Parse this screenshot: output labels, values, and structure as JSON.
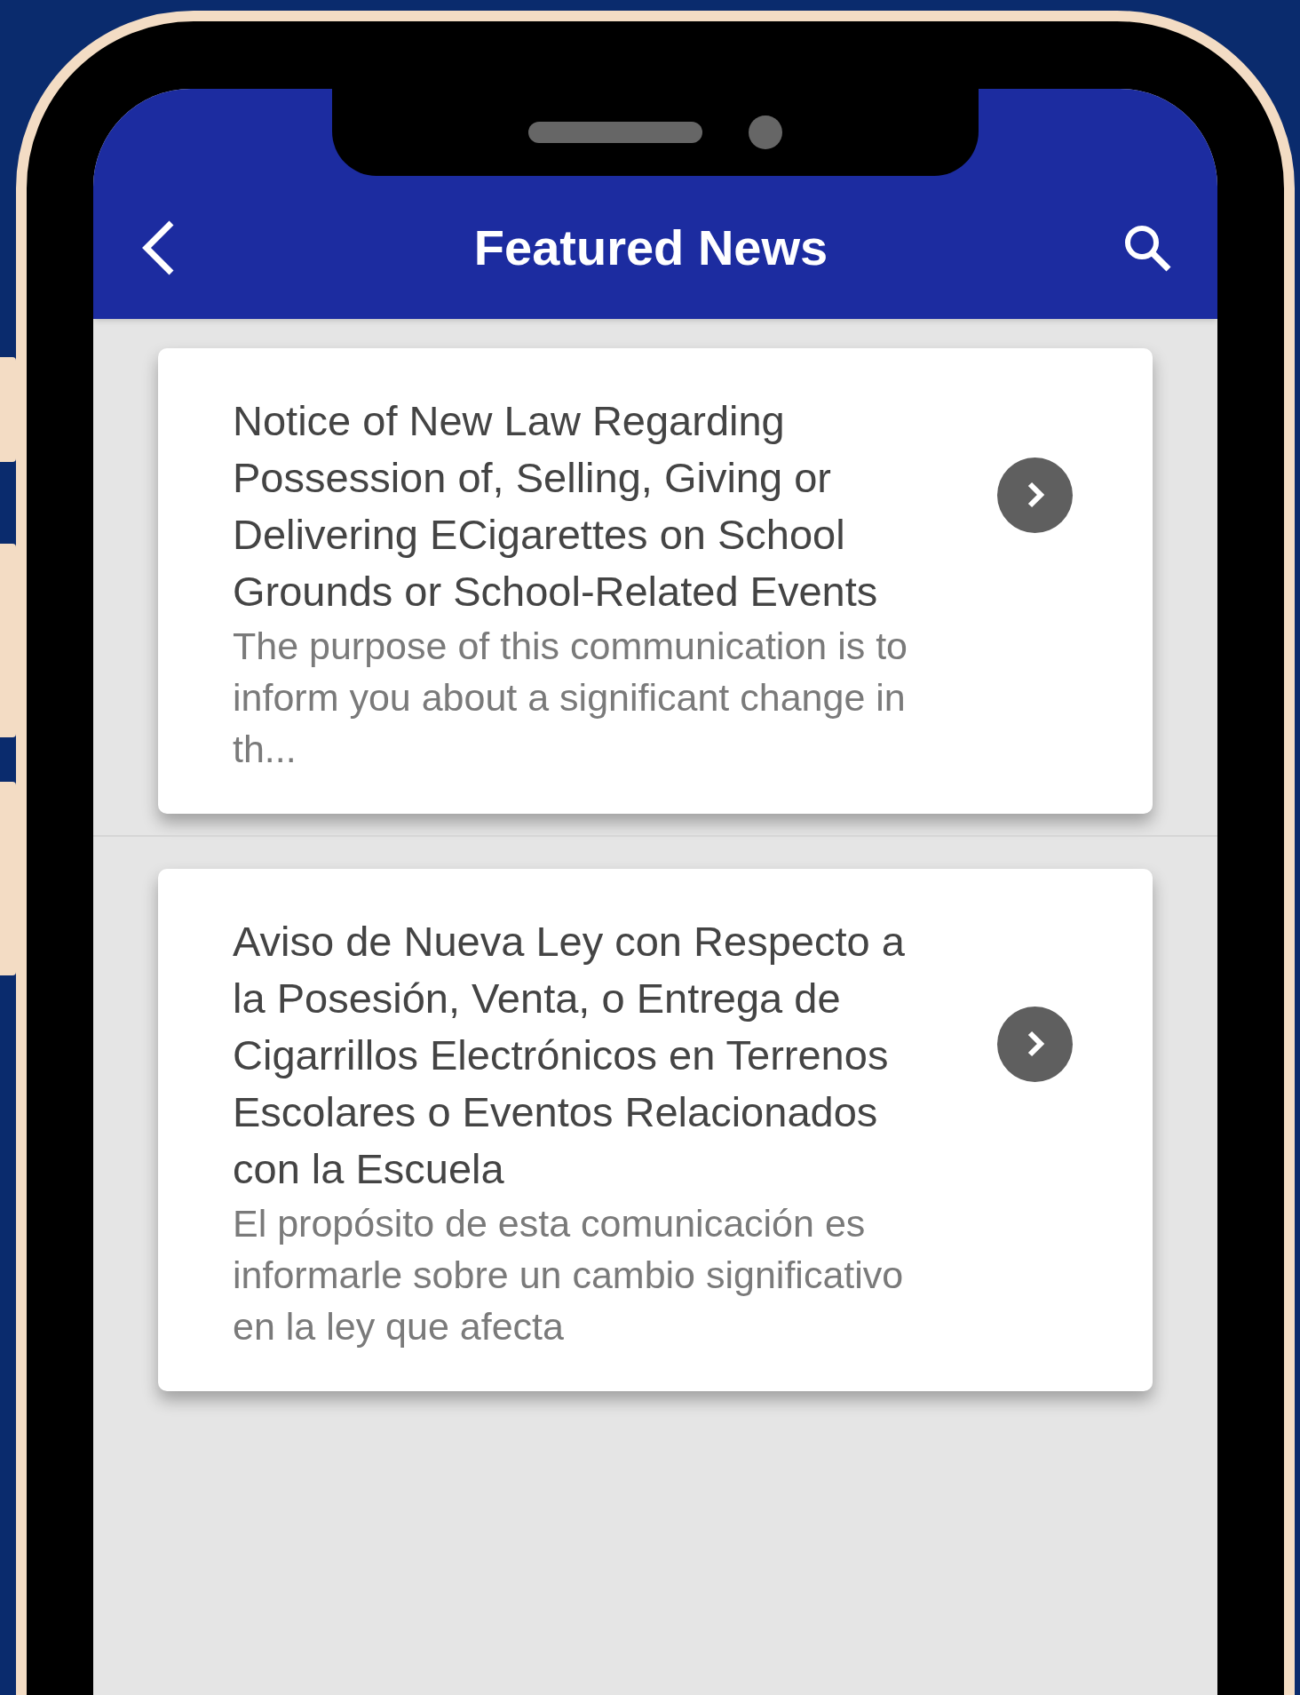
{
  "app_bar": {
    "title": "Featured News"
  },
  "news_items": [
    {
      "title": "Notice of New Law Regarding Possession of, Selling, Giving or Delivering ECigarettes on School Grounds or School-Related Events",
      "summary": "The purpose of this communication is to inform you about a significant change in th..."
    },
    {
      "title": "Aviso de Nueva Ley con Respecto a la Posesión, Venta, o Entrega de Cigarrillos Electrónicos en Terrenos Escolares o Eventos Relacionados con la Escuela",
      "summary": "El propósito de esta comunicación es informarle sobre un cambio significativo en la ley que afecta"
    }
  ]
}
